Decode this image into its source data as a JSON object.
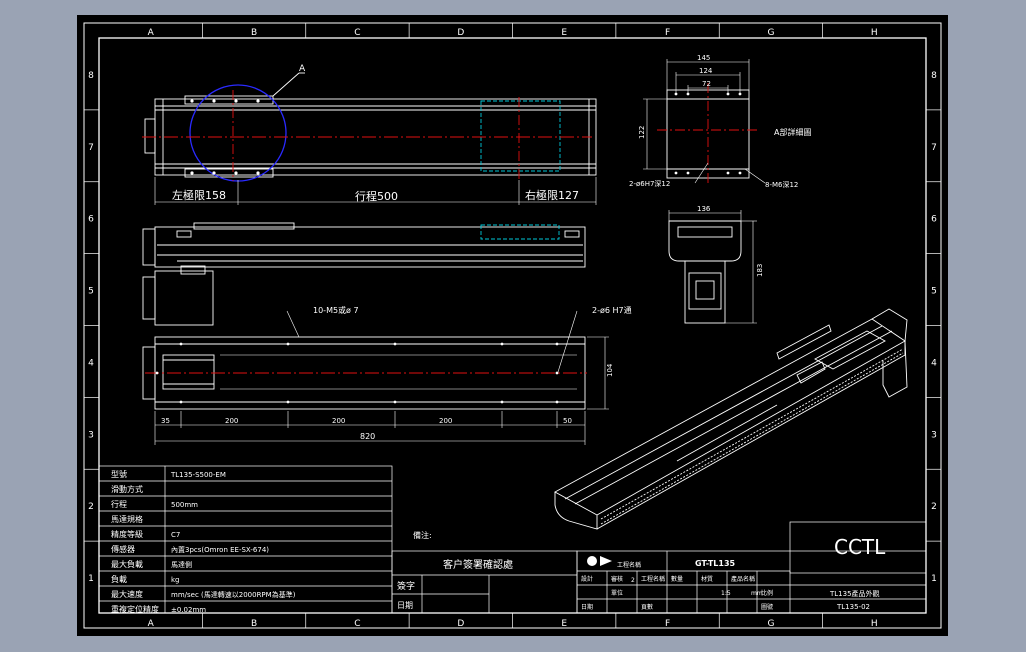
{
  "grid": {
    "cols": [
      "A",
      "B",
      "C",
      "D",
      "E",
      "F",
      "G",
      "H"
    ],
    "rows": [
      "8",
      "7",
      "6",
      "5",
      "4",
      "3",
      "2",
      "1"
    ]
  },
  "top_view": {
    "detail_label": "A",
    "left_limit": "左極限158",
    "travel": "行程500",
    "right_limit": "右極限127"
  },
  "bottom_view": {
    "hole_note_left": "10-M5或ø 7",
    "hole_note_right": "2-ø6 H7通",
    "dims": [
      "35",
      "200",
      "200",
      "200",
      "50"
    ],
    "total": "820",
    "height": "104"
  },
  "detail_view": {
    "dim1": "145",
    "dim2": "124",
    "dim3": "72",
    "dim_left": "122",
    "label": "A部詳細圖",
    "note1": "2-ø6H7深12",
    "note2": "8-M6深12"
  },
  "end_view": {
    "width": "136",
    "height": "183"
  },
  "spec_table": [
    {
      "label": "型號",
      "value": "TL135-S500-EM"
    },
    {
      "label": "滑動方式",
      "value": ""
    },
    {
      "label": "行程",
      "value": "500mm"
    },
    {
      "label": "馬達規格",
      "value": ""
    },
    {
      "label": "精度等級",
      "value": "C7"
    },
    {
      "label": "傳感器",
      "value": "內置3pcs(Omron EE-SX-674)"
    },
    {
      "label": "最大負載",
      "value": "馬達側"
    },
    {
      "label": "負載",
      "value": "kg"
    },
    {
      "label": "最大速度",
      "value": "mm/sec (馬達轉速以2000RPM為基準)"
    },
    {
      "label": "重複定位精度",
      "value": "±0.02mm"
    }
  ],
  "notes_label": "備注:",
  "confirm": {
    "title": "客户簽署確認處",
    "sign": "簽字",
    "date": "日期"
  },
  "title_block": {
    "company_logo": "CCTL",
    "drawing_no": "GT-TL135",
    "product_name": "TL135產品外觀",
    "part_no": "TL135-02",
    "headers": [
      "設計",
      "審核",
      "工程名稱",
      "數量",
      "材質",
      "產品名稱",
      "比例",
      "單位",
      "圖號",
      "日期",
      "頁數"
    ],
    "values": [
      "2",
      "1:5",
      "mm"
    ]
  }
}
